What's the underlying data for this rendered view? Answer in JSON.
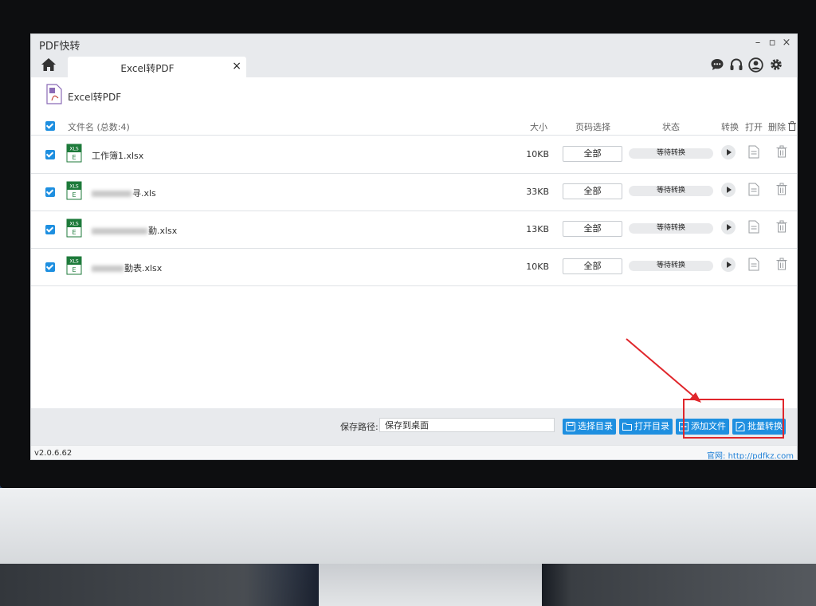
{
  "window": {
    "title": "PDF快转",
    "controls": {
      "minimize": "–",
      "maximize": "▫",
      "close": "×"
    }
  },
  "tabbar": {
    "tab_label": "Excel转PDF",
    "tab_close": "×",
    "icons": [
      "home-icon",
      "chat-icon",
      "headset-icon",
      "user-icon",
      "gear-icon"
    ]
  },
  "section": {
    "title": "Excel转PDF",
    "icon": "pdf-file-icon"
  },
  "columns": {
    "filename": "文件名 (总数:4)",
    "size": "大小",
    "page": "页码选择",
    "status": "状态",
    "convert": "转换",
    "open": "打开",
    "delete": "删除"
  },
  "files": [
    {
      "name_prefix": "",
      "name": "工作簿1.xlsx",
      "size": "10KB",
      "page": "全部",
      "status": "等待转换"
    },
    {
      "name_prefix": "",
      "name": "寻.xls",
      "size": "33KB",
      "page": "全部",
      "status": "等待转换"
    },
    {
      "name_prefix": "",
      "name": "勤.xlsx",
      "size": "13KB",
      "page": "全部",
      "status": "等待转换"
    },
    {
      "name_prefix": "",
      "name": "勤表.xlsx",
      "size": "10KB",
      "page": "全部",
      "status": "等待转换"
    }
  ],
  "file_icon_label": "XLS",
  "file_icon_letter": "E",
  "bottombar": {
    "path_label": "保存路径:",
    "path_value": "保存到桌面",
    "buttons": {
      "choose_dir": "选择目录",
      "open_dir": "打开目录",
      "add_file": "添加文件",
      "batch_convert": "批量转换"
    }
  },
  "statusbar": {
    "version": "v2.0.6.62",
    "site": "官网: http://pdfkz.com"
  },
  "colors": {
    "accent": "#1e8fe0",
    "highlight": "#e0262b",
    "excel_green": "#1d7a3a"
  }
}
